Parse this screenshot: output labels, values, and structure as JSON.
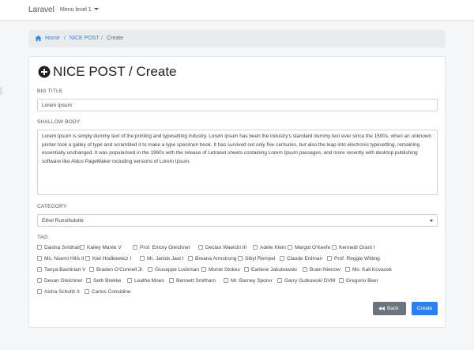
{
  "navbar": {
    "brand": "Laravel",
    "menu_label": "Menu level 1"
  },
  "breadcrumb": {
    "home": "Home",
    "section": "NICE POST",
    "current": "Create",
    "separator": "/"
  },
  "page": {
    "title": "NICE POST / Create"
  },
  "form": {
    "big_title": {
      "label": "BIG TITLE",
      "value": "Lorem Ipsum"
    },
    "shallow_body": {
      "label": "SHALLOW BODY",
      "value": "Lorem Ipsum is simply dummy text of the printing and typesetting industry. Lorem Ipsum has been the industry's standard dummy text ever since the 1500s, when an unknown printer took a galley of type and scrambled it to make a type specimen book. It has survived not only five centuries, but also the leap into electronic typesetting, remaining essentially unchanged. It was popularised in the 1960s with the release of Letraset sheets containing Lorem Ipsum passages, and more recently with desktop publishing software like Aldus PageMaker including versions of Lorem Ipsum."
    },
    "category": {
      "label": "CATEGORY",
      "selected": "Ethel Runolfsdottir"
    },
    "tag": {
      "label": "TAG",
      "options": [
        "Daisha Smitham",
        "Kailey Mante V",
        "Prof. Emory Gleichner",
        "Declan Waelchi III",
        "Adele Klein",
        "Margot O'Keefe",
        "Kennedi Grant I",
        "Ms. Noemi Hills II",
        "Kiel Hodkiewicz I",
        "Mr. Janick Jast I",
        "Breana Armstrong",
        "Sibyl Rempel",
        "Claude Erdman",
        "Prof. Reggie Witting",
        "Tanya Bashirian V",
        "Braden O'Connell Jr.",
        "Giuseppe Lockman",
        "Monte Stokes",
        "Earlene Jakubowski",
        "Brain Nienow",
        "Ms. Kali Kovacek",
        "Devan Gleichner",
        "Seth Brekke",
        "Leatha Moen",
        "Bennett Smitham",
        "Mr. Barney Sporer",
        "Garry Gutkowski DVM",
        "Gregorio Beer",
        "Aisha Schultz II",
        "Carlos Considine"
      ]
    }
  },
  "buttons": {
    "back": "Back",
    "create": "Create"
  },
  "colors": {
    "primary": "#2f80e8",
    "secondary": "#6c757d",
    "link": "#3b82d6"
  }
}
